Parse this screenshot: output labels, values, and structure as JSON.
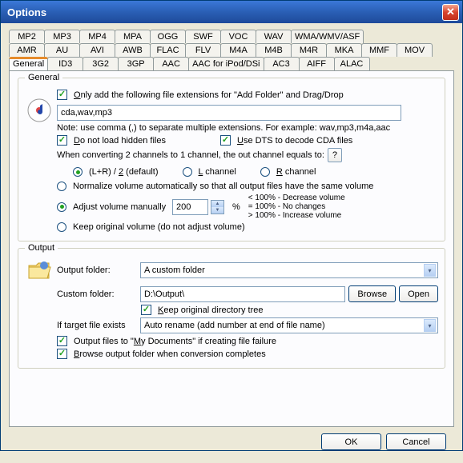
{
  "window": {
    "title": "Options"
  },
  "tabs_row1": [
    "MP2",
    "MP3",
    "MP4",
    "MPA",
    "OGG",
    "SWF",
    "VOC",
    "WAV",
    "WMA/WMV/ASF"
  ],
  "tabs_row2": [
    "AMR",
    "AU",
    "AVI",
    "AWB",
    "FLAC",
    "FLV",
    "M4A",
    "M4B",
    "M4R",
    "MKA",
    "MMF",
    "MOV"
  ],
  "tabs_row3": [
    "General",
    "ID3",
    "3G2",
    "3GP",
    "AAC",
    "AAC for iPod/DSi",
    "AC3",
    "AIFF",
    "ALAC"
  ],
  "general": {
    "legend": "General",
    "only_add_label_pre": "O",
    "only_add_label": "nly add the following file extensions for \"Add Folder\" and Drag/Drop",
    "ext_value": "cda,wav,mp3",
    "note": "Note: use comma (,) to separate multiple extensions. For example: wav,mp3,m4a,aac",
    "hidden_pre": "D",
    "hidden_label": "o not load hidden files",
    "dts_pre": "U",
    "dts_label": "se DTS to decode CDA files",
    "convert_label": "When converting 2 channels to 1 channel, the out channel equals to:",
    "r_lr_pre": "(L+R) / ",
    "r_lr_u": "2",
    "r_lr_post": " (default)",
    "r_l_u": "L",
    "r_l_post": " channel",
    "r_r_u": "R",
    "r_r_post": " channel",
    "norm_label": "Normalize volume automatically so that all output files have the same volume",
    "adj_label": "Adjust volume manually",
    "adj_value": "200",
    "pct": "%",
    "vol_line1": "< 100% - Decrease volume",
    "vol_line2": "= 100% - No changes",
    "vol_line3": "> 100% - Increase volume",
    "keep_vol_label": "Keep original volume (do not adjust volume)"
  },
  "output": {
    "legend": "Output",
    "folder_label": "Output folder:",
    "folder_value": "A custom folder",
    "custom_label": "Custom folder:",
    "custom_value": "D:\\Output\\",
    "browse": "Browse",
    "open": "Open",
    "keep_tree_u": "K",
    "keep_tree_label": "eep original directory tree",
    "target_label": "If target file exists",
    "target_value": "Auto rename (add number at end of file name)",
    "mydocs_pre": "Output files to \"",
    "mydocs_u": "M",
    "mydocs_post": "y Documents\" if creating file failure",
    "browse_done_u": "B",
    "browse_done_label": "rowse output folder when conversion completes"
  },
  "footer": {
    "ok": "OK",
    "cancel": "Cancel"
  }
}
